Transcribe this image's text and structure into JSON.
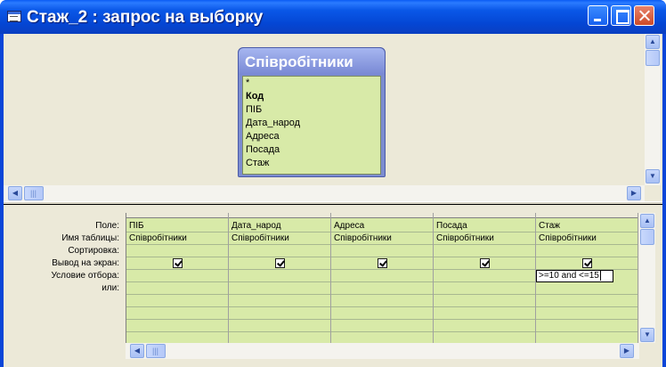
{
  "window": {
    "title": "Стаж_2 : запрос на выборку",
    "icon": "query-icon"
  },
  "table": {
    "name": "Співробітники",
    "fields": [
      "*",
      "Код",
      "ПІБ",
      "Дата_народ",
      "Адреса",
      "Посада",
      "Стаж"
    ],
    "key_field": "Код"
  },
  "grid": {
    "row_labels": {
      "field": "Поле:",
      "table": "Имя таблицы:",
      "sort": "Сортировка:",
      "show": "Вывод на экран:",
      "criteria": "Условие отбора:",
      "or": "или:"
    },
    "columns": [
      {
        "field": "ПІБ",
        "table": "Співробітники",
        "sort": "",
        "show": true,
        "criteria": ""
      },
      {
        "field": "Дата_народ",
        "table": "Співробітники",
        "sort": "",
        "show": true,
        "criteria": ""
      },
      {
        "field": "Адреса",
        "table": "Співробітники",
        "sort": "",
        "show": true,
        "criteria": ""
      },
      {
        "field": "Посада",
        "table": "Співробітники",
        "sort": "",
        "show": true,
        "criteria": ""
      },
      {
        "field": "Стаж",
        "table": "Співробітники",
        "sort": "",
        "show": true,
        "criteria": ">=10 and <=15"
      }
    ]
  },
  "colors": {
    "titlebar": "#0a58e8",
    "table_header": "#7888d4",
    "field_background": "#d8eaa8",
    "client": "#ece9d8"
  }
}
